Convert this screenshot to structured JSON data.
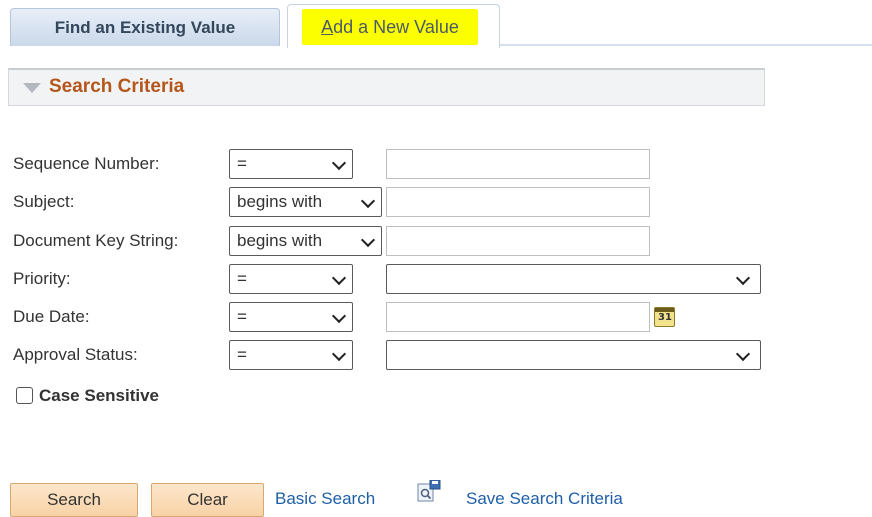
{
  "tabs": {
    "find_label": "Find an Existing Value",
    "add_label_first": "A",
    "add_label_rest": "dd a New Value"
  },
  "criteria": {
    "title": "Search Criteria"
  },
  "fields": {
    "sequence_number": {
      "label": "Sequence Number:",
      "operator": "="
    },
    "subject": {
      "label": "Subject:",
      "operator": "begins with"
    },
    "document_key_string": {
      "label": "Document Key String:",
      "operator": "begins with"
    },
    "priority": {
      "label": "Priority:",
      "operator": "="
    },
    "due_date": {
      "label": "Due Date:",
      "operator": "="
    },
    "approval_status": {
      "label": "Approval Status:",
      "operator": "="
    }
  },
  "calendar": {
    "number": "31"
  },
  "case_sensitive": {
    "label": "Case Sensitive"
  },
  "buttons": {
    "search": "Search",
    "clear": "Clear"
  },
  "links": {
    "basic_search": "Basic Search",
    "save_search_criteria": "Save Search Criteria"
  },
  "colors": {
    "highlight": "#fbff00",
    "section_title": "#b5561b",
    "link": "#1e5fa8",
    "button_bg": "#f8d2a6"
  },
  "icons": {
    "collapse": "triangle-down-icon",
    "calendar": "calendar-icon",
    "save_search": "save-search-icon"
  }
}
